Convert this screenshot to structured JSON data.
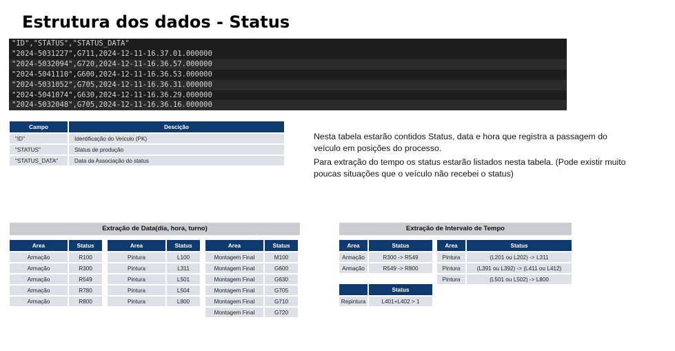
{
  "title": "Estrutura dos dados - Status",
  "code_lines": [
    "\"ID\",\"STATUS\",\"STATUS_DATA\"",
    "\"2024-5031227\",G711,2024-12-11-16.37.01.000000",
    "\"2024-5032094\",G720,2024-12-11-16.36.57.000000",
    "\"2024-5041110\",G600,2024-12-11-16.36.53.000000",
    "\"2024-5031052\",G705,2024-12-11-16.36.31.000000",
    "\"2024-5041074\",G630,2024-12-11-16.36.29.000000",
    "\"2024-5032048\",G705,2024-12-11-16.36.16.000000"
  ],
  "field_table": {
    "headers": [
      "Campo",
      "Descição"
    ],
    "rows": [
      [
        "\"ID\"",
        "Identificação do Veículo (PK)"
      ],
      [
        "\"STATUS\"",
        "Status de produção"
      ],
      [
        "\"STATUS_DATA\"",
        "Data da Associação do status"
      ]
    ]
  },
  "description": {
    "p1": "Nesta tabela estarão contidos Status, data e hora que registra a passagem do veículo em posições do processo.",
    "p2": "Para extração do tempo os status estarão listados nesta tabela. (Pode existir muito poucas situações que o veículo não recebei o status)"
  },
  "extracao_data": {
    "title": "Extração de Data(dia, hora, turno)",
    "tables": [
      {
        "headers": [
          "Area",
          "Status"
        ],
        "rows": [
          [
            "Armação",
            "R100"
          ],
          [
            "Armação",
            "R300"
          ],
          [
            "Armação",
            "R549"
          ],
          [
            "Armação",
            "R780"
          ],
          [
            "Armação",
            "R800"
          ]
        ]
      },
      {
        "headers": [
          "Area",
          "Status"
        ],
        "rows": [
          [
            "Pintura",
            "L100"
          ],
          [
            "Pintura",
            "L311"
          ],
          [
            "Pintura",
            "L501"
          ],
          [
            "Pintura",
            "L504"
          ],
          [
            "Pintura",
            "L800"
          ]
        ]
      },
      {
        "headers": [
          "Area",
          "Status"
        ],
        "rows": [
          [
            "Montagem Final",
            "M100"
          ],
          [
            "Montagem Final",
            "G600"
          ],
          [
            "Montagem Final",
            "G630"
          ],
          [
            "Montagem Final",
            "G705"
          ],
          [
            "Montagem Final",
            "G710"
          ],
          [
            "Montagem Final",
            "G720"
          ]
        ]
      }
    ]
  },
  "extracao_intervalo": {
    "title": "Extração de Intervalo de Tempo",
    "armacao": {
      "headers": [
        "Area",
        "Status"
      ],
      "rows": [
        [
          "Armação",
          "R300 -> R549"
        ],
        [
          "Armação",
          "R549 -> R800"
        ]
      ]
    },
    "pintura": {
      "headers": [
        "Area",
        "Status"
      ],
      "rows": [
        [
          "Pintura",
          "(L201 ou L202) -> L311"
        ],
        [
          "Pintura",
          "(L391 ou L392) -> (L411 ou L412)"
        ],
        [
          "Pintura",
          "(L501 ou L502) -> L800"
        ]
      ]
    },
    "repintura": {
      "headers": [
        "",
        "Status"
      ],
      "rows": [
        [
          "Repintura",
          "L401+L402 > 1"
        ]
      ]
    }
  }
}
